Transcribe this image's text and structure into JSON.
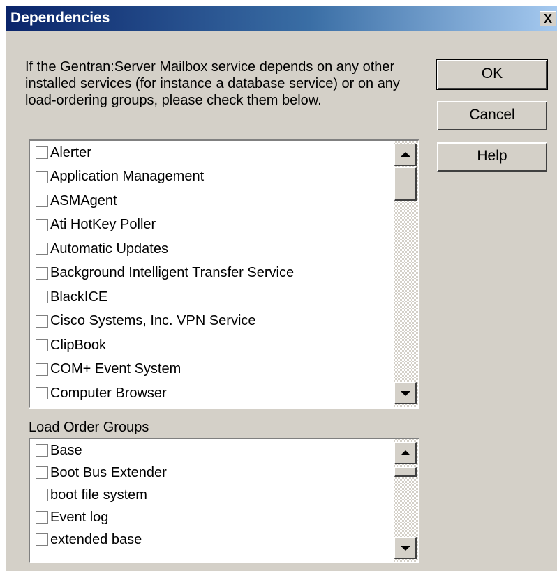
{
  "window": {
    "title": "Dependencies",
    "close_glyph": "X"
  },
  "prompt": "If the Gentran:Server Mailbox service depends on any other installed services (for instance a database service) or on any load-ordering groups, please check them below.",
  "buttons": {
    "ok": "OK",
    "cancel": "Cancel",
    "help": "Help"
  },
  "services": [
    {
      "label": "Alerter",
      "checked": false
    },
    {
      "label": "Application Management",
      "checked": false
    },
    {
      "label": "ASMAgent",
      "checked": false
    },
    {
      "label": "Ati HotKey Poller",
      "checked": false
    },
    {
      "label": "Automatic Updates",
      "checked": false
    },
    {
      "label": "Background Intelligent Transfer Service",
      "checked": false
    },
    {
      "label": "BlackICE",
      "checked": false
    },
    {
      "label": "Cisco Systems, Inc. VPN Service",
      "checked": false
    },
    {
      "label": "ClipBook",
      "checked": false
    },
    {
      "label": "COM+ Event System",
      "checked": false
    },
    {
      "label": "Computer Browser",
      "checked": false
    }
  ],
  "load_order_groups_label": "Load Order Groups",
  "load_order_groups": [
    {
      "label": "Base",
      "checked": false
    },
    {
      "label": "Boot Bus Extender",
      "checked": false
    },
    {
      "label": "boot file system",
      "checked": false
    },
    {
      "label": "Event log",
      "checked": false
    },
    {
      "label": "extended base",
      "checked": false
    }
  ],
  "icons": {
    "close": "close-icon",
    "scroll_up": "chevron-up-icon",
    "scroll_down": "chevron-down-icon"
  }
}
